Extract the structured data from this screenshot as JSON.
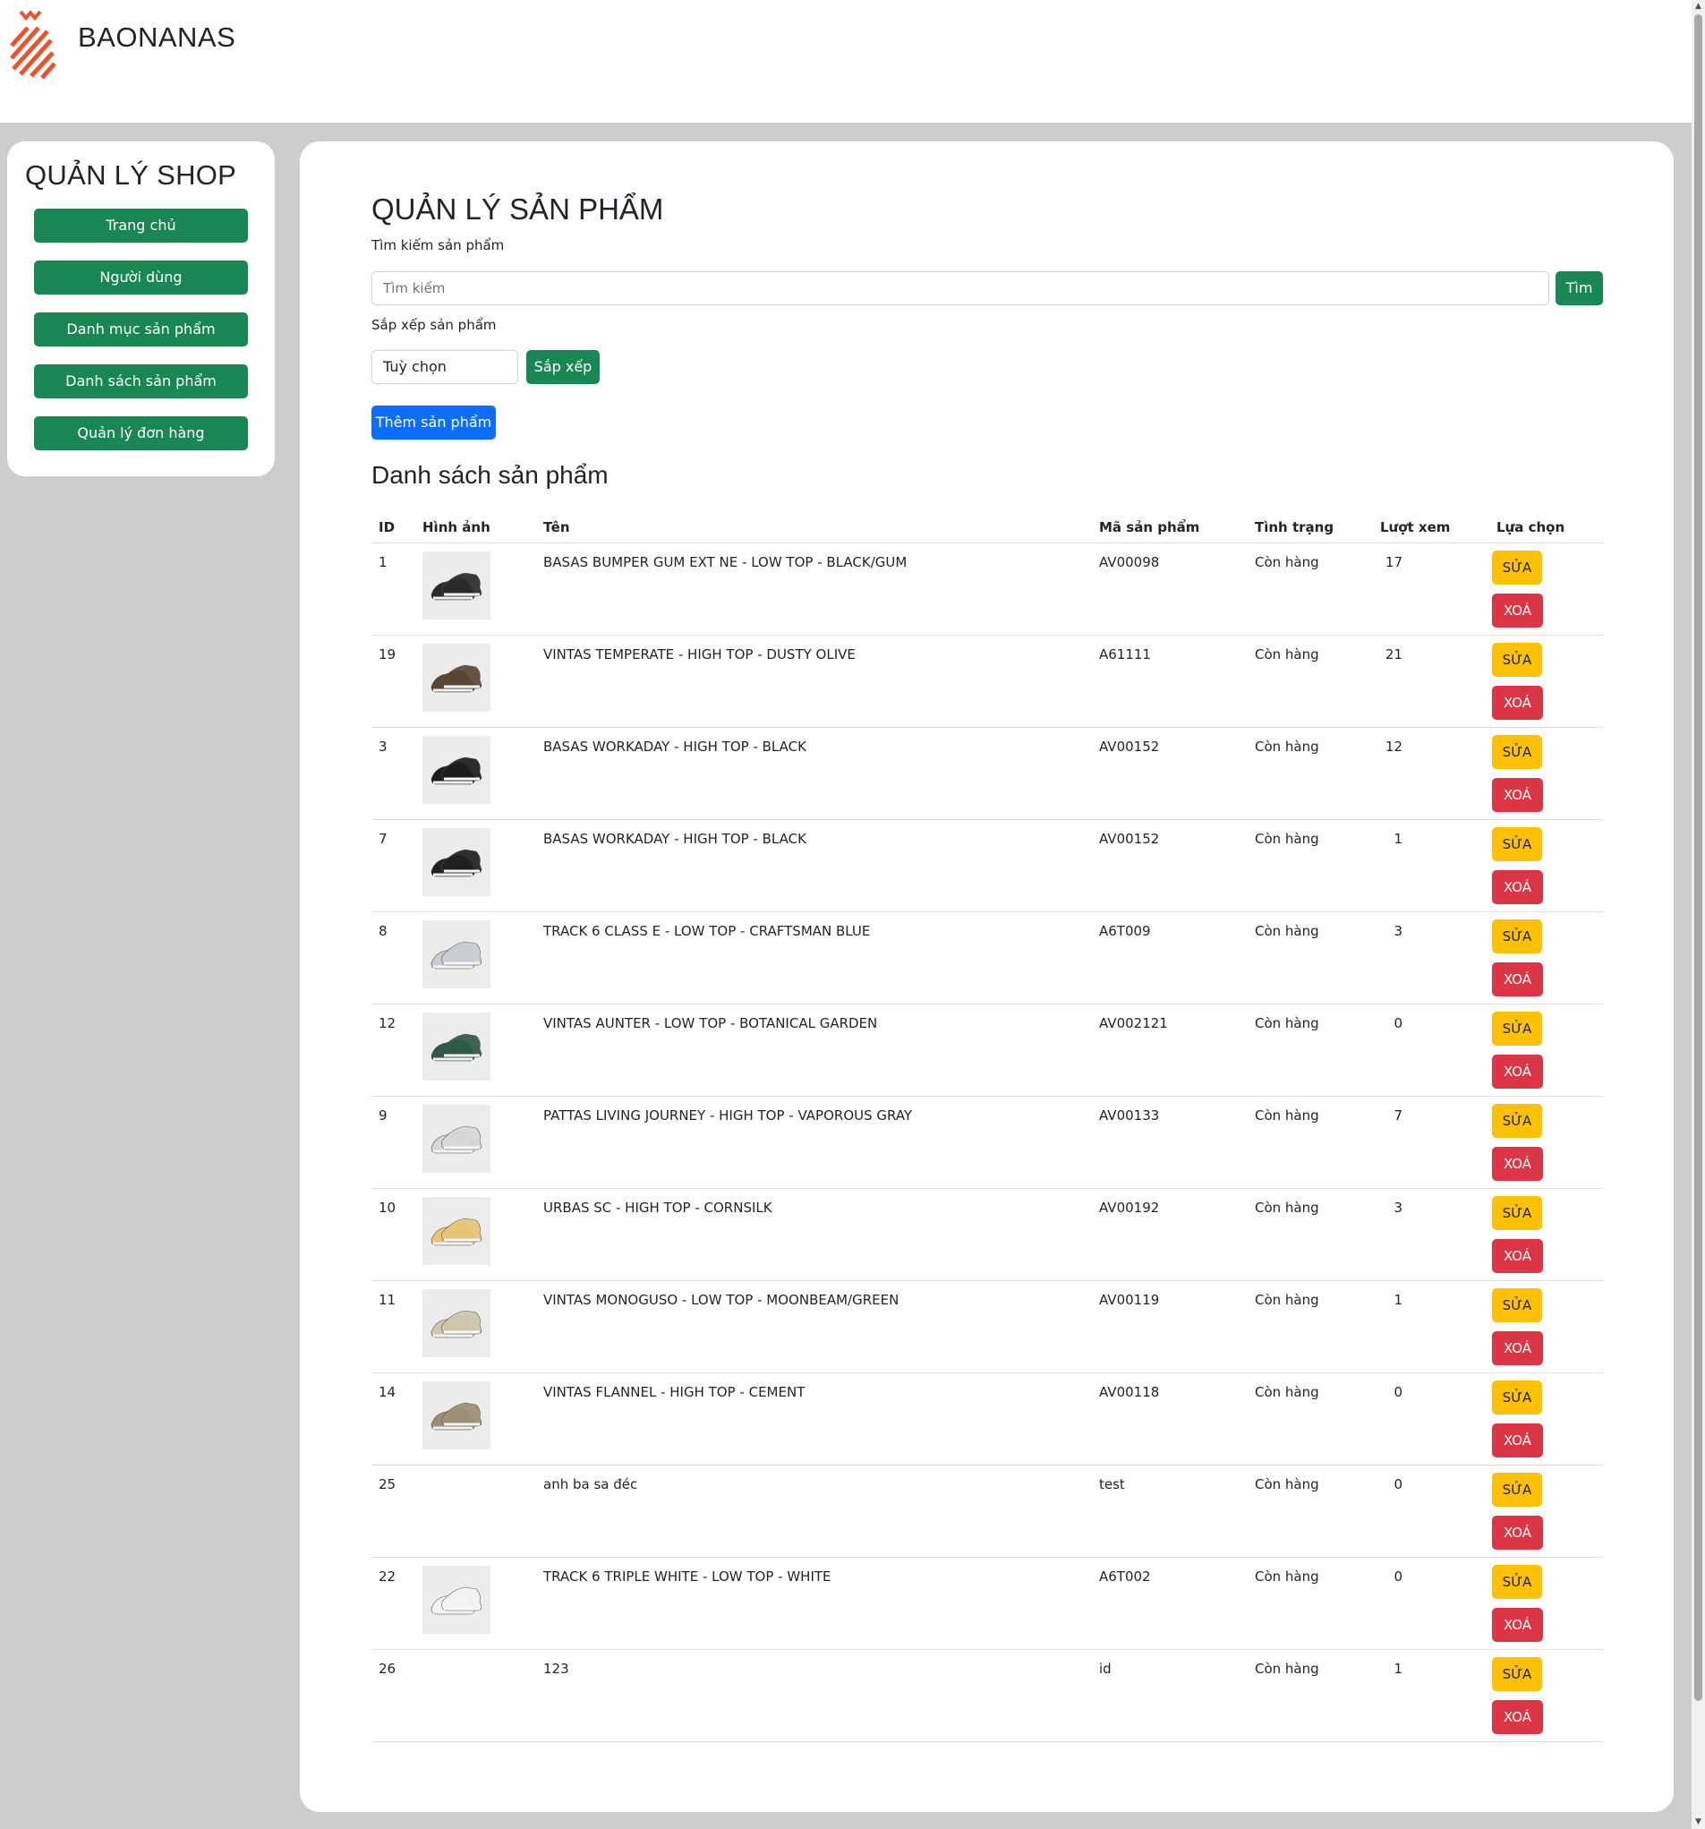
{
  "header": {
    "brand": "BAONANAS"
  },
  "sidebar": {
    "title": "QUẢN LÝ SHOP",
    "items": [
      "Trang chủ",
      "Người dùng",
      "Danh mục sản phẩm",
      "Danh sách sản phẩm",
      "Quản lý đơn hàng"
    ]
  },
  "main": {
    "title": "QUẢN LÝ SẢN PHẨM",
    "search_label": "Tìm kiếm sản phẩm",
    "search_placeholder": "Tìm kiếm",
    "search_button": "Tìm",
    "sort_label": "Sắp xếp sản phẩm",
    "sort_value": "Tuỳ chọn",
    "sort_button": "Sắp xếp",
    "add_button": "Thêm sản phẩm",
    "list_title": "Danh sách sản phẩm"
  },
  "table": {
    "columns": [
      "ID",
      "Hình ảnh",
      "Tên",
      "Mã sản phẩm",
      "Tình trạng",
      "Lượt xem",
      "Lựa chọn"
    ],
    "edit_label": "SỬA",
    "delete_label": "XOÁ",
    "rows": [
      {
        "id": "1",
        "name": "BASAS BUMPER GUM EXT NE - LOW TOP - BLACK/GUM",
        "code": "AV00098",
        "status": "Còn hàng",
        "views": "17",
        "image": true,
        "shoe_color": "#2a2a2a"
      },
      {
        "id": "19",
        "name": "VINTAS TEMPERATE - HIGH TOP - DUSTY OLIVE",
        "code": "A61111",
        "status": "Còn hàng",
        "views": "21",
        "image": true,
        "shoe_color": "#5b4636"
      },
      {
        "id": "3",
        "name": "BASAS WORKADAY - HIGH TOP - BLACK",
        "code": "AV00152",
        "status": "Còn hàng",
        "views": "12",
        "image": true,
        "shoe_color": "#1c1c1c"
      },
      {
        "id": "7",
        "name": "BASAS WORKADAY - HIGH TOP - BLACK",
        "code": "AV00152",
        "status": "Còn hàng",
        "views": "1",
        "image": true,
        "shoe_color": "#202020"
      },
      {
        "id": "8",
        "name": "TRACK 6 CLASS E - LOW TOP - CRAFTSMAN BLUE",
        "code": "A6T009",
        "status": "Còn hàng",
        "views": "3",
        "image": true,
        "shoe_color": "#c9ccd2"
      },
      {
        "id": "12",
        "name": "VINTAS AUNTER - LOW TOP - BOTANICAL GARDEN",
        "code": "AV002121",
        "status": "Còn hàng",
        "views": "0",
        "image": true,
        "shoe_color": "#2f5a45"
      },
      {
        "id": "9",
        "name": "PATTAS LIVING JOURNEY - HIGH TOP - VAPOROUS GRAY",
        "code": "AV00133",
        "status": "Còn hàng",
        "views": "7",
        "image": true,
        "shoe_color": "#d6d8d8"
      },
      {
        "id": "10",
        "name": "URBAS SC - HIGH TOP - CORNSILK",
        "code": "AV00192",
        "status": "Còn hàng",
        "views": "3",
        "image": true,
        "shoe_color": "#e6c577"
      },
      {
        "id": "11",
        "name": "VINTAS MONOGUSO - LOW TOP - MOONBEAM/GREEN",
        "code": "AV00119",
        "status": "Còn hàng",
        "views": "1",
        "image": true,
        "shoe_color": "#cfc6ad"
      },
      {
        "id": "14",
        "name": "VINTAS FLANNEL - HIGH TOP - CEMENT",
        "code": "AV00118",
        "status": "Còn hàng",
        "views": "0",
        "image": true,
        "shoe_color": "#9c8f76"
      },
      {
        "id": "25",
        "name": "anh ba sa đéc",
        "code": "test",
        "status": "Còn hàng",
        "views": "0",
        "image": false,
        "shoe_color": ""
      },
      {
        "id": "22",
        "name": "TRACK 6 TRIPLE WHITE - LOW TOP - WHITE",
        "code": "A6T002",
        "status": "Còn hàng",
        "views": "0",
        "image": true,
        "shoe_color": "#f4f4f4"
      },
      {
        "id": "26",
        "name": "123",
        "code": "id",
        "status": "Còn hàng",
        "views": "1",
        "image": false,
        "shoe_color": ""
      }
    ]
  },
  "colors": {
    "primary_green": "#198754",
    "primary_blue": "#0d6efd",
    "warning": "#ffc107",
    "danger": "#dc3545",
    "logo_orange": "#e8542e"
  }
}
